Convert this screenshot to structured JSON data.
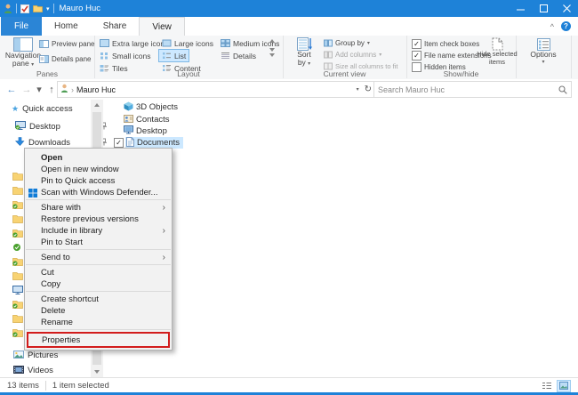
{
  "colors": {
    "accent": "#1e82d8",
    "selection": "#cce8ff",
    "annotation_red": "#d21c1c"
  },
  "icons": {
    "back": "←",
    "forward": "→",
    "up": "↑",
    "dropdown": "▾",
    "breadcrumb_chevron": "›",
    "submenu_arrow": "›",
    "refresh": "↻",
    "collapse_ribbon": "^",
    "help": "?",
    "check": "✓",
    "star": "★"
  },
  "titlebar": {
    "title": "Mauro Huc"
  },
  "tabs": {
    "file": "File",
    "home": "Home",
    "share": "Share",
    "view": "View"
  },
  "ribbon": {
    "panes": {
      "navigation_line1": "Navigation",
      "navigation_line2": "pane",
      "preview": "Preview pane",
      "details": "Details pane",
      "group_label": "Panes"
    },
    "layout": {
      "extra_large": "Extra large icons",
      "large": "Large icons",
      "medium": "Medium icons",
      "small": "Small icons",
      "list": "List",
      "details": "Details",
      "tiles": "Tiles",
      "content": "Content",
      "selected": "List",
      "group_label": "Layout"
    },
    "current_view": {
      "sort_line1": "Sort",
      "sort_line2": "by",
      "group_by": "Group by",
      "add_columns": "Add columns",
      "size_columns": "Size all columns to fit",
      "group_label": "Current view"
    },
    "show_hide": {
      "item_check_boxes": "Item check boxes",
      "file_name_extensions": "File name extensions",
      "hidden_items": "Hidden items",
      "hide_selected_line1": "Hide selected",
      "hide_selected_line2": "items",
      "group_label": "Show/hide"
    },
    "options": {
      "label": "Options"
    }
  },
  "address_bar": {
    "location": "Mauro Huc",
    "search_placeholder": "Search Mauro Huc"
  },
  "sidebar": {
    "quick_access": "Quick access",
    "desktop": "Desktop",
    "downloads": "Downloads",
    "pictures": "Pictures",
    "videos": "Videos"
  },
  "file_list": {
    "items": [
      "3D Objects",
      "Contacts",
      "Desktop",
      "Documents"
    ],
    "selected": "Documents"
  },
  "context_menu": {
    "items": [
      "Open",
      "Open in new window",
      "Pin to Quick access",
      "Scan with Windows Defender...",
      "Share with",
      "Restore previous versions",
      "Include in library",
      "Pin to Start",
      "Send to",
      "Cut",
      "Copy",
      "Create shortcut",
      "Delete",
      "Rename",
      "Properties"
    ],
    "highlighted": "Properties"
  },
  "status_bar": {
    "items_count": "13 items",
    "selection_count": "1 item selected"
  }
}
